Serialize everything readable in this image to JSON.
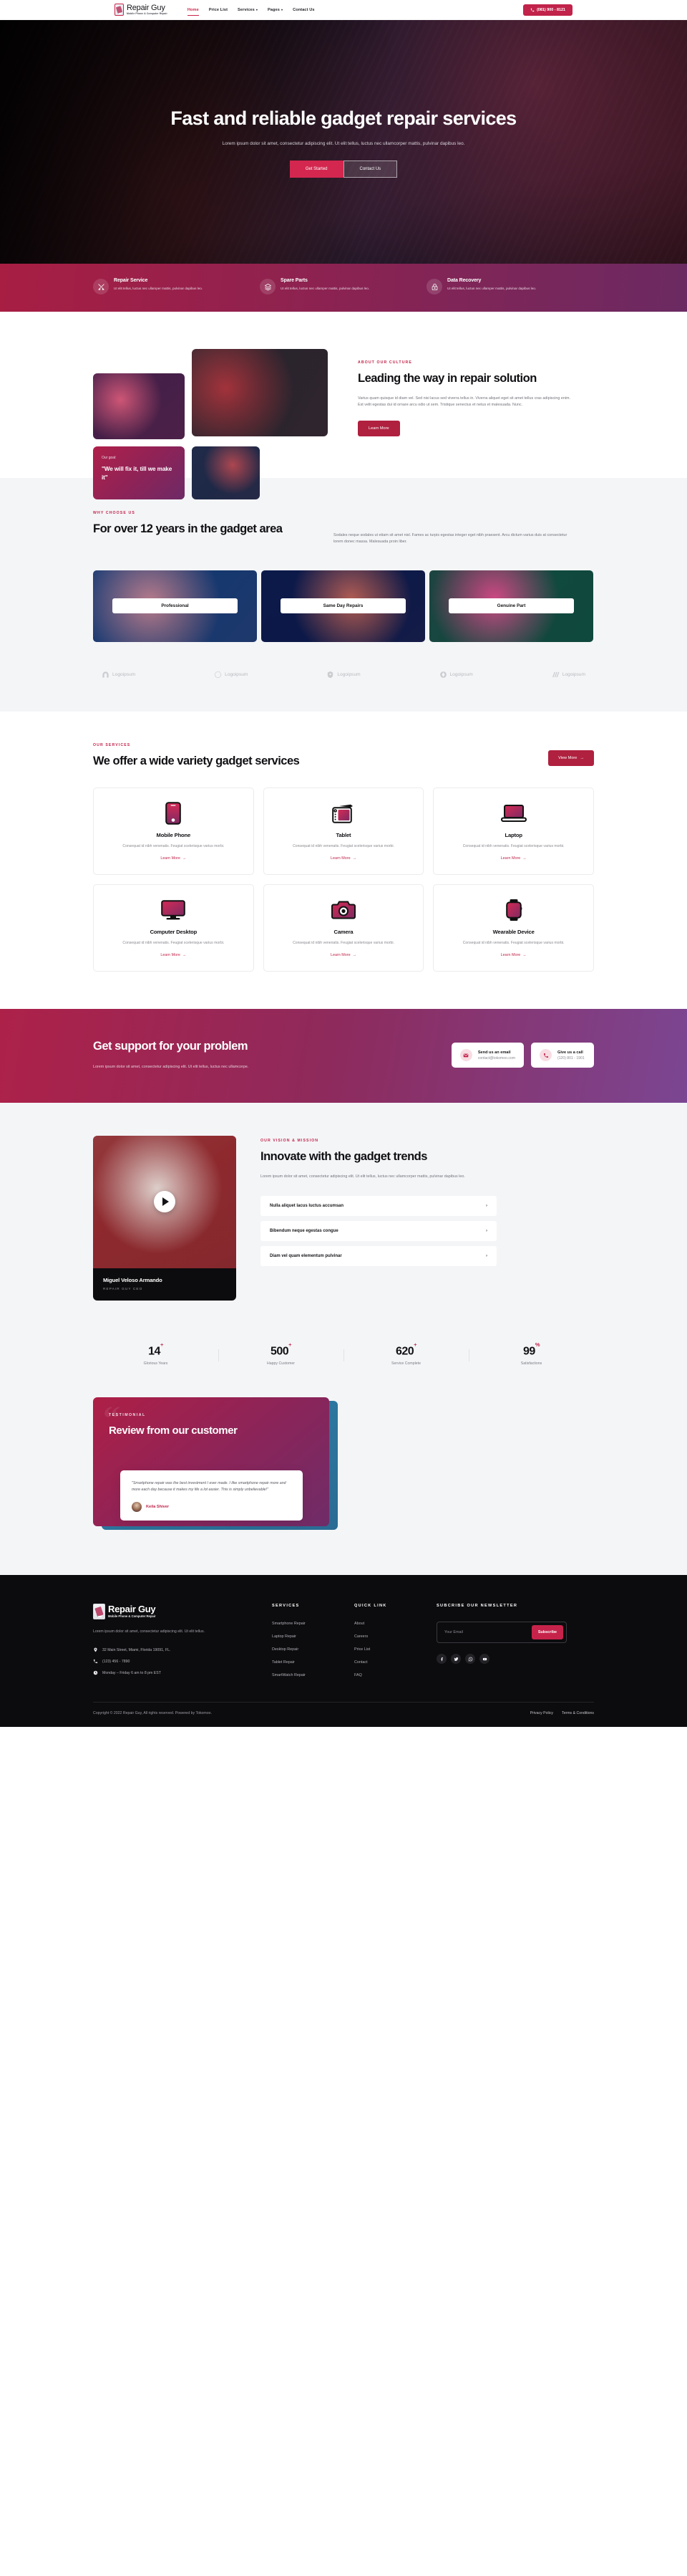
{
  "header": {
    "brand_name": "Repair Guy",
    "brand_tagline": "Mobile Phone & Computer Repair",
    "nav": [
      {
        "label": "Home",
        "active": true,
        "caret": false
      },
      {
        "label": "Price List",
        "active": false,
        "caret": false
      },
      {
        "label": "Services",
        "active": false,
        "caret": true
      },
      {
        "label": "Pages",
        "active": false,
        "caret": true
      },
      {
        "label": "Contact Us",
        "active": false,
        "caret": false
      }
    ],
    "phone_button": "(081) 900 - 8121"
  },
  "hero": {
    "title": "Fast and reliable gadget repair services",
    "subtitle": "Lorem ipsum dolor sit amet, consectetur adipiscing elit. Ut elit tellus, luctus nec ullamcorper mattis, pulvinar dapibus leo.",
    "primary_button": "Get Started",
    "secondary_button": "Contact Us"
  },
  "feature_bar": [
    {
      "icon": "tools-icon",
      "title": "Repair Service",
      "text": "Ut elit tellus, luctus nec ullamper mattis, pulvinar dapibus leo."
    },
    {
      "icon": "layers-icon",
      "title": "Spare Parts",
      "text": "Ut elit tellus, luctus nec ullamper mattis, pulvinar dapibus leo."
    },
    {
      "icon": "lock-icon",
      "title": "Data Recovery",
      "text": "Ut elit tellus, luctus nec ullamper mattis, pulvinar dapibus leo."
    }
  ],
  "about": {
    "eyebrow": "ABOUT OUR CULTURE",
    "title": "Leading the way in repair solution",
    "body": "Varius quam quisque id diam vel. Sed nisi lacus sed viverra tellus in. Viverra aliquet eget sit amet tellus cras adipiscing enim. Est velit egestas dui id ornare arcu odio ut sem. Tristique senectus et netus et malesuada. Nunc.",
    "button": "Learn More",
    "goal_label": "Our goal:",
    "goal_quote": "\"We will fix it, till we make it\""
  },
  "why": {
    "eyebrow": "WHY CHOOSE US",
    "title": "For over 12 years in the gadget area",
    "body": "Sodales neque sodales ut etiam sit amet nisl. Fames ac turpis egestas integer eget nibh praesent. Arcu dictum varius duis at consectetur lorem donec massa. Malesuada proin liber.",
    "cards": [
      "Professional",
      "Same Day Repairs",
      "Genuine Part"
    ],
    "logos": [
      "Logoipsum",
      "Logoipsum",
      "Logoipsum",
      "Logoipsum",
      "Logoipsum"
    ]
  },
  "services": {
    "eyebrow": "OUR SERVICES",
    "title": "We offer a wide variety gadget services",
    "view_more": "View More",
    "items": [
      {
        "icon": "mobile-phone-icon",
        "title": "Mobile Phone",
        "text": "Consequat id nibh venenatis. Feugiat scelerisque varius morbi.",
        "link": "Learn More"
      },
      {
        "icon": "tablet-icon",
        "title": "Tablet",
        "text": "Consequat id nibh venenatis. Feugiat scelerisque varius morbi.",
        "link": "Learn More"
      },
      {
        "icon": "laptop-icon",
        "title": "Laptop",
        "text": "Consequat id nibh venenatis. Feugiat scelerisque varius morbi.",
        "link": "Learn More"
      },
      {
        "icon": "desktop-icon",
        "title": "Computer Desktop",
        "text": "Consequat id nibh venenatis. Feugiat scelerisque varius morbi.",
        "link": "Learn More"
      },
      {
        "icon": "camera-icon",
        "title": "Camera",
        "text": "Consequat id nibh venenatis. Feugiat scelerisque varius morbi.",
        "link": "Learn More"
      },
      {
        "icon": "watch-icon",
        "title": "Wearable Device",
        "text": "Consequat id nibh venenatis. Feugiat scelerisque varius morbi.",
        "link": "Learn More"
      }
    ]
  },
  "support": {
    "title": "Get support for your problem",
    "body": "Lorem ipsum dolor sit amet, consectetur adipiscing elit. Ut elit tellus, luctus nec ullamcorpe.",
    "email_card": {
      "icon": "envelope-icon",
      "title": "Send us an email",
      "value": "contact@tokomoo.com"
    },
    "call_card": {
      "icon": "phone-icon",
      "title": "Give us a call",
      "value": "(120) 801 - 1901"
    }
  },
  "vision": {
    "eyebrow": "OUR VISION & MISSION",
    "title": "Innovate with the gadget trends",
    "body": "Lorem ipsum dolor sit amet, consectetur adipiscing elit. Ut elit tellus, luctus nec ullamcorper mattis, pulvinar dapibus leo.",
    "person_name": "Miguel Veloso Armando",
    "person_role": "REPAIR GUY CEO",
    "accordion": [
      "Nulla aliquet lacus luctus accumsan",
      "Bibendum neque egestas congue",
      "Diam vel quam elementum pulvinar"
    ]
  },
  "stats": [
    {
      "value": "14",
      "suffix": "+",
      "label": "Glorious Years"
    },
    {
      "value": "500",
      "suffix": "+",
      "label": "Happy Customer"
    },
    {
      "value": "620",
      "suffix": "+",
      "label": "Service Complete"
    },
    {
      "value": "99",
      "suffix": "%",
      "label": "Satisfactions"
    }
  ],
  "testimonial": {
    "eyebrow": "TESTIMONIAL",
    "title": "Review from our customer",
    "quote": "\"Smartphone repair was the best investment I ever made. I like smartphone repair more and more each day because it makes my life a lot easier. This is simply unbelievable!\"",
    "author": "Keila Shiver"
  },
  "footer": {
    "brand_name": "Repair Guy",
    "brand_tagline": "Mobile Phone & Computer Repair",
    "description": "Lorem ipsum dolor sit amet, consectetur adipiscing elit. Ut elit tellus.",
    "address": "32 Main Street, Miami, Florida 19091, FL.",
    "phone": "(123) 456 - 7890",
    "hours": "Monday – Friday 6 am to 8 pm EST",
    "services_heading": "SERVICES",
    "services": [
      "Smartphone Repair",
      "Laptop Repair",
      "Desktop Repair",
      "Tablet Repair",
      "SmartWatch Repair"
    ],
    "quicklink_heading": "QUICK LINK",
    "quicklinks": [
      "About",
      "Careers",
      "Price List",
      "Contact",
      "FAQ"
    ],
    "newsletter_heading": "SUBCRIBE OUR NEWSLETTER",
    "email_placeholder": "Your Email",
    "subscribe_button": "Subscribe",
    "socials": [
      "facebook-icon",
      "twitter-icon",
      "whatsapp-icon",
      "youtube-icon"
    ],
    "copyright": "Copyright © 2022 Repair Guy, All rights reserved. Powered by Tokomoo.",
    "bottom_links": [
      "Privacy Policy",
      "Terms & Conditions"
    ]
  },
  "colors": {
    "brand_red": "#c1234a",
    "deep_magenta": "#8d2258",
    "dark": "#0c0b0d"
  }
}
